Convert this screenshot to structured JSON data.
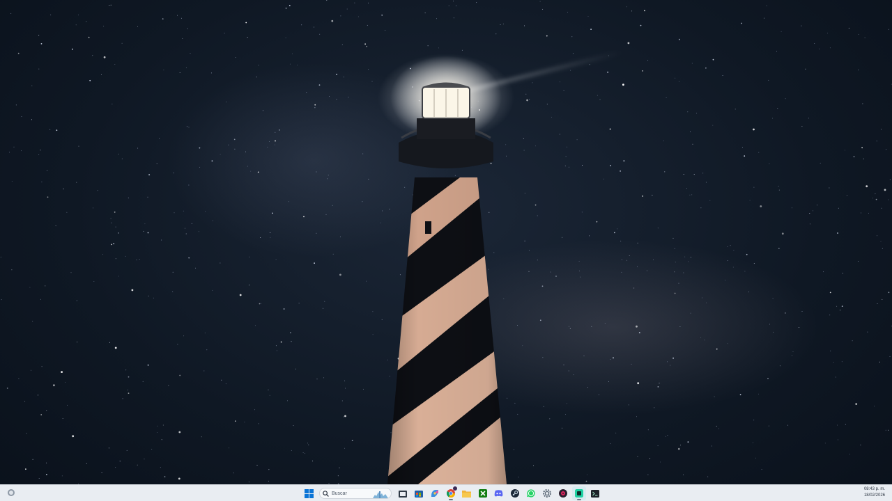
{
  "desktop": {
    "wallpaper": "lighthouse-night-milky-way"
  },
  "taskbar": {
    "widgets_icon": "weather-widget-icon",
    "start_icon": "windows-start-icon",
    "search": {
      "placeholder": "Buscar"
    },
    "pinned_apps": [
      {
        "name": "file-explorer-icon"
      },
      {
        "name": "store-icon"
      },
      {
        "name": "copilot-icon"
      },
      {
        "name": "chrome-icon"
      },
      {
        "name": "folder-icon"
      },
      {
        "name": "xbox-icon"
      },
      {
        "name": "discord-icon"
      },
      {
        "name": "steam-icon"
      },
      {
        "name": "whatsapp-icon"
      },
      {
        "name": "settings-icon"
      },
      {
        "name": "media-player-icon"
      },
      {
        "name": "app-green-icon"
      },
      {
        "name": "terminal-icon"
      }
    ],
    "clock": {
      "time": "08:43 p. m.",
      "date": "18/02/2026"
    }
  },
  "colors": {
    "taskbar_bg": "#e9edf2",
    "accent": "#0078d4"
  }
}
